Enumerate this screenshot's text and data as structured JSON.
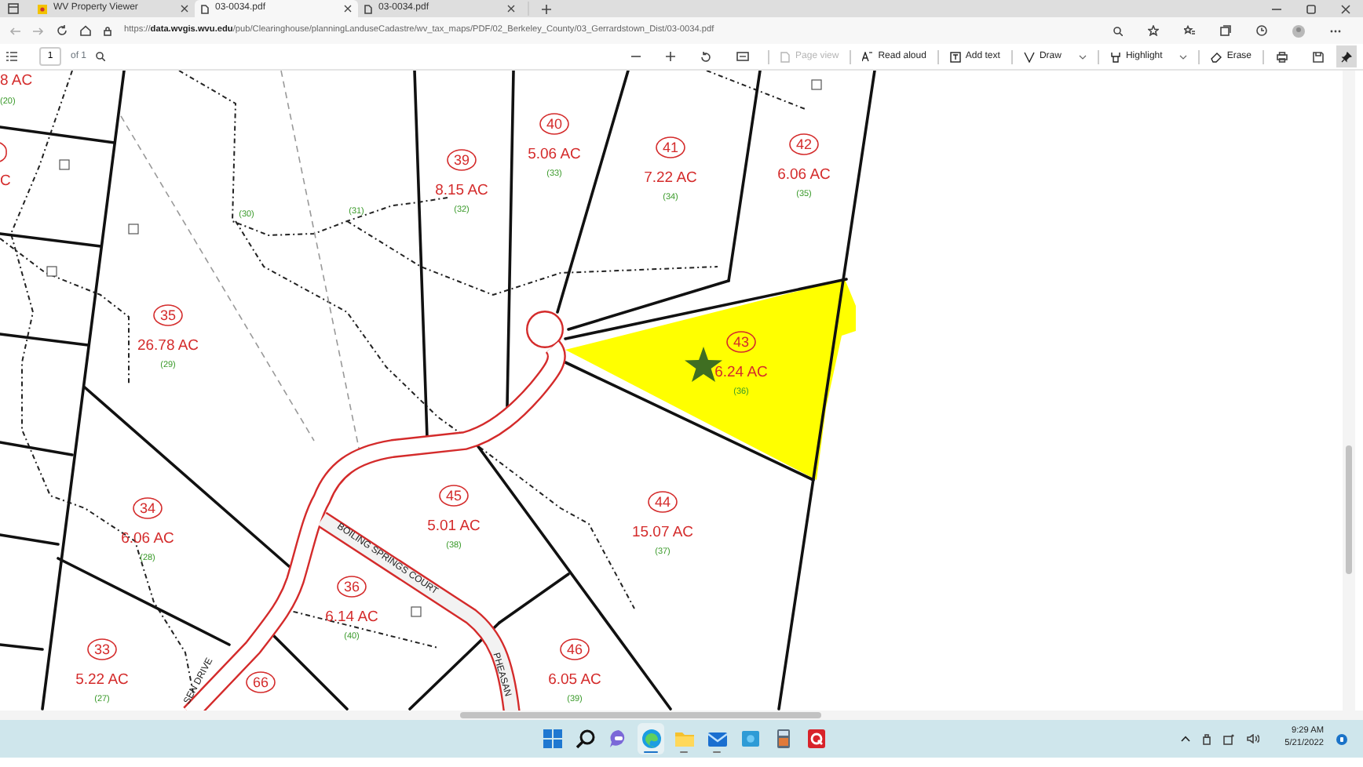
{
  "browser": {
    "tabs": [
      {
        "title": "WV Property Viewer",
        "selected": false
      },
      {
        "title": "03-0034.pdf",
        "selected": true
      },
      {
        "title": "03-0034.pdf",
        "selected": false
      }
    ],
    "address": "https://**data.wvgis.wvu.edu**/pub/Clearinghouse/planningLanduseCadastre/wv_tax_maps/PDF/02_Berkeley_County/03_Gerrardstown_Dist/03-0034.pdf"
  },
  "pdf_toolbar": {
    "page": "1",
    "page_count": "of 1",
    "pinned": true,
    "tools": [
      {
        "label": "Page view",
        "disabled": true,
        "dropdown": false
      },
      {
        "label": "Read aloud",
        "disabled": false,
        "dropdown": false
      },
      {
        "label": "Add text",
        "disabled": false,
        "dropdown": false
      },
      {
        "label": "Draw",
        "disabled": false,
        "dropdown": true
      },
      {
        "label": "Highlight",
        "disabled": false,
        "dropdown": true
      },
      {
        "label": "Erase",
        "disabled": false,
        "dropdown": false
      }
    ]
  },
  "map": {
    "parcels": [
      {
        "number": "39",
        "acreage": "8.15 AC",
        "code": "(32)"
      },
      {
        "number": "40",
        "acreage": "5.06 AC",
        "code": "(33)"
      },
      {
        "number": "41",
        "acreage": "7.22 AC",
        "code": "(34)"
      },
      {
        "number": "42",
        "acreage": "6.06 AC",
        "code": "(35)"
      },
      {
        "number": "35",
        "acreage": "26.78 AC",
        "code": "(29)"
      },
      {
        "number": "43",
        "acreage": "6.24 AC",
        "code": "(36)"
      },
      {
        "number": "34",
        "acreage": "6.06 AC",
        "code": "(28)"
      },
      {
        "number": "45",
        "acreage": "5.01 AC",
        "code": "(38)"
      },
      {
        "number": "44",
        "acreage": "15.07 AC",
        "code": "(37)"
      },
      {
        "number": "36",
        "acreage": "6.14 AC",
        "code": "(40)"
      },
      {
        "number": "33",
        "acreage": "5.22 AC",
        "code": "(27)"
      },
      {
        "number": "66"
      },
      {
        "number": "46",
        "acreage": "6.05 AC",
        "code": "(39)"
      }
    ],
    "edge_labels": [
      {
        "text": "8 AC",
        "kind": "acreage"
      },
      {
        "text": "(20)",
        "kind": "code"
      },
      {
        "text": "C",
        "kind": "acreage"
      }
    ],
    "trail_labels": [
      "(30)",
      "(31)"
    ],
    "streets": [
      "BOILING SPRINGS COURT",
      "SEN DRIVE",
      "PHEASAN"
    ]
  },
  "taskbar": {
    "apps": [
      {
        "kind": "start",
        "running": false,
        "active": false
      },
      {
        "kind": "search",
        "running": false,
        "active": false
      },
      {
        "kind": "chat",
        "running": false,
        "active": false
      },
      {
        "kind": "edge",
        "running": true,
        "active": true
      },
      {
        "kind": "explorer",
        "running": true,
        "active": false
      },
      {
        "kind": "mail",
        "running": true,
        "active": false
      },
      {
        "kind": "store",
        "running": false,
        "active": false
      },
      {
        "kind": "calculator",
        "running": false,
        "active": false
      },
      {
        "kind": "office",
        "running": false,
        "active": false
      }
    ],
    "clock": {
      "time": "9:29 AM",
      "date": "5/21/2022"
    }
  }
}
